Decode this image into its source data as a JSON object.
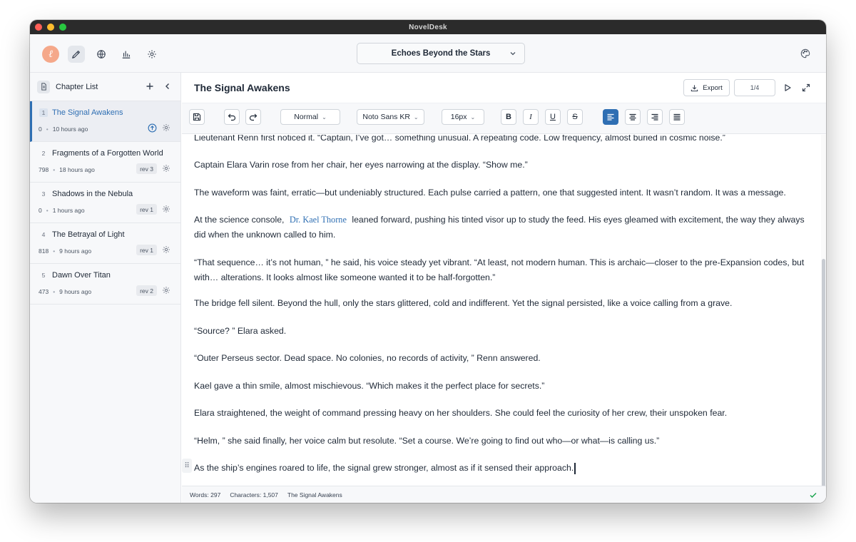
{
  "app": {
    "title": "NovelDesk"
  },
  "project": {
    "name": "Echoes Beyond the Stars"
  },
  "sidebar": {
    "title": "Chapter List",
    "chapters": [
      {
        "num": "1",
        "title": "The Signal Awakens",
        "words": "0",
        "time": "10 hours ago",
        "rev": "",
        "active": true
      },
      {
        "num": "2",
        "title": "Fragments of a Forgotten World",
        "words": "798",
        "time": "18 hours ago",
        "rev": "rev 3"
      },
      {
        "num": "3",
        "title": "Shadows in the Nebula",
        "words": "0",
        "time": "1 hours ago",
        "rev": "rev 1"
      },
      {
        "num": "4",
        "title": "The Betrayal of Light",
        "words": "818",
        "time": "9 hours ago",
        "rev": "rev 1"
      },
      {
        "num": "5",
        "title": "Dawn Over Titan",
        "words": "473",
        "time": "9 hours ago",
        "rev": "rev 2"
      }
    ]
  },
  "document": {
    "title": "The Signal Awakens",
    "export_label": "Export",
    "page_counter": "1/4"
  },
  "toolbar": {
    "paragraph_style": "Normal",
    "font": "Noto Sans KR",
    "font_size": "16px"
  },
  "editor": {
    "paragraphs": [
      "Lieutenant Renn first noticed it. “Captain, I’ve got… something unusual. A repeating code. Low frequency, almost buried in cosmic noise.”",
      "Captain Elara Varin rose from her chair, her eyes narrowing at the display. “Show me.”",
      "The waveform was faint, erratic—but undeniably structured. Each pulse carried a pattern, one that suggested intent. It wasn’t random. It was a message.",
      "“That sequence… it’s not human, ” he said, his voice steady yet vibrant. “At least, not modern human. This is archaic—closer to the pre-Expansion codes, but with… alterations. It looks almost like someone wanted it to be half-forgotten.”",
      "The bridge fell silent. Beyond the hull, only the stars glittered, cold and indifferent. Yet the signal persisted, like a voice calling from a grave.",
      "“Source? ” Elara asked.",
      "“Outer Perseus sector. Dead space. No colonies, no records of activity, ” Renn answered.",
      "Kael gave a thin smile, almost mischievous. “Which makes it the perfect place for secrets.”",
      "Elara straightened, the weight of command pressing heavy on her shoulders. She could feel the curiosity of her crew, their unspoken fear.",
      "“Helm, ” she said finally, her voice calm but resolute. “Set a course. We’re going to find out who—or what—is calling us.”",
      "As the ship’s engines roared to life, the signal grew stronger, almost as if it sensed their approach."
    ],
    "p4_before": "At the science console,",
    "p4_mention": "Dr. Kael Thorne",
    "p4_after": "leaned forward, pushing his tinted visor up to study the feed. His eyes gleamed with excitement, the way they always did when the unknown called to him."
  },
  "status": {
    "words": "Words: 297",
    "characters": "Characters: 1,507",
    "chapter": "The Signal Awakens"
  },
  "colors": {
    "accent": "#2f6fb3",
    "logo": "#f5a88a",
    "saved": "#16a34a"
  }
}
